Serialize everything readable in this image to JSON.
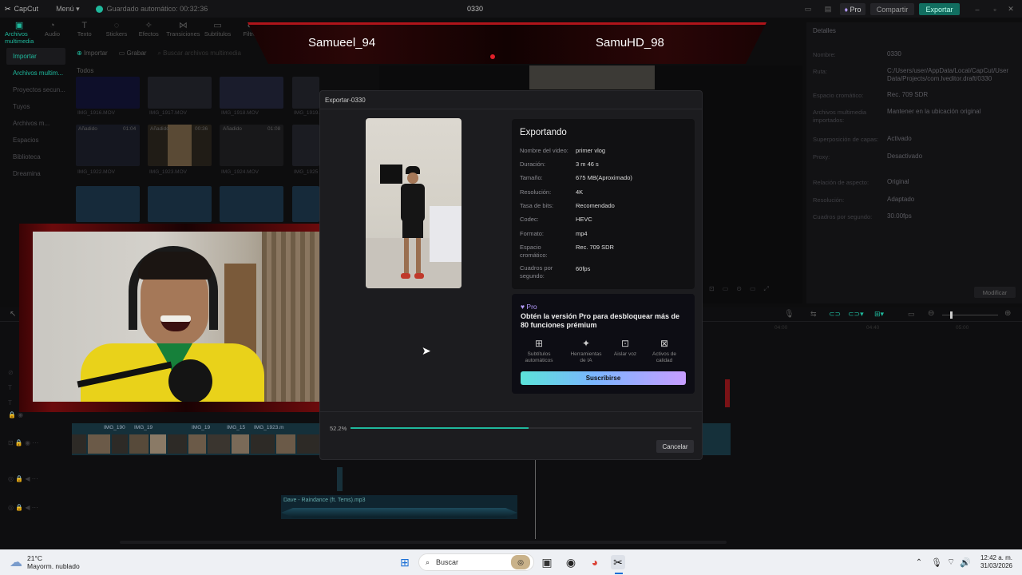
{
  "titlebar": {
    "app_name": "CapCut",
    "menu": "Menú",
    "autosave": "Guardado automático: 00:32:36",
    "project": "0330",
    "pro": "Pro",
    "share": "Compartir",
    "export": "Exportar"
  },
  "toolbar": [
    {
      "label": "Archivos multimedia",
      "icon": "media-icon"
    },
    {
      "label": "Audio",
      "icon": "audio-icon"
    },
    {
      "label": "Texto",
      "icon": "text-icon"
    },
    {
      "label": "Stickers",
      "icon": "sticker-icon"
    },
    {
      "label": "Efectos",
      "icon": "effects-icon"
    },
    {
      "label": "Transiciones",
      "icon": "transitions-icon"
    },
    {
      "label": "Subtítulos",
      "icon": "subtitles-icon"
    },
    {
      "label": "Filtro",
      "icon": "filter-icon"
    }
  ],
  "leftnav": [
    "Importar",
    "Archivos multim...",
    "Proyectos secun...",
    "Tuyos",
    "Archivos m...",
    "Espacios",
    "Biblioteca",
    "Dreamina"
  ],
  "media": {
    "import": "Importar",
    "record": "Grabar",
    "search_placeholder": "Buscar archivos multimedia",
    "all": "Todos",
    "clips": [
      {
        "name": "IMG_1916.MOV",
        "badge": "",
        "dur": ""
      },
      {
        "name": "IMG_1917.MOV",
        "badge": "",
        "dur": ""
      },
      {
        "name": "IMG_1918.MOV",
        "badge": "",
        "dur": ""
      },
      {
        "name": "IMG_1919.MOV",
        "badge": "",
        "dur": ""
      },
      {
        "name": "IMG_1922.MOV",
        "badge": "Añadido",
        "dur": "01:04"
      },
      {
        "name": "IMG_1923.MOV",
        "badge": "Añadido",
        "dur": "00:36"
      },
      {
        "name": "IMG_1924.MOV",
        "badge": "Añadido",
        "dur": "01:08"
      },
      {
        "name": "IMG_1925",
        "badge": "",
        "dur": ""
      }
    ]
  },
  "overlay": {
    "left_name": "Samueel_94",
    "right_name": "SamuHD_98"
  },
  "dialog": {
    "title": "Exportar-0330",
    "heading": "Exportando",
    "rows": [
      {
        "label": "Nombre del video:",
        "value": "primer vlog"
      },
      {
        "label": "Duración:",
        "value": "3 m 46 s"
      },
      {
        "label": "Tamaño:",
        "value": "675 MB(Aproximado)"
      },
      {
        "label": "Resolución:",
        "value": "4K"
      },
      {
        "label": "Tasa de bits:",
        "value": "Recomendado"
      },
      {
        "label": "Codec:",
        "value": "HEVC"
      },
      {
        "label": "Formato:",
        "value": "mp4"
      },
      {
        "label": "Espacio cromático:",
        "value": "Rec. 709 SDR"
      },
      {
        "label": "Cuadros por segundo:",
        "value": "60fps"
      }
    ],
    "pro": {
      "tag": "Pro",
      "message": "Obtén la versión Pro para desbloquear más de 80 funciones prémium",
      "features": [
        {
          "label": "Subtítulos automáticos",
          "icon": "captions-icon"
        },
        {
          "label": "Herramientas de IA",
          "icon": "ai-tools-icon"
        },
        {
          "label": "Aislar voz",
          "icon": "isolate-voice-icon"
        },
        {
          "label": "Activos de calidad",
          "icon": "quality-assets-icon"
        }
      ],
      "subscribe": "Suscribirse"
    },
    "progress_text": "52.2%",
    "progress": 0.522,
    "cancel": "Cancelar"
  },
  "details": {
    "title": "Detalles",
    "rows": [
      {
        "label": "Nombre:",
        "value": "0330"
      },
      {
        "label": "Ruta:",
        "value": "C:/Users/user/AppData/Local/CapCut/User Data/Projects/com.lveditor.draft/0330"
      },
      {
        "label": "Espacio cromático:",
        "value": "Rec. 709 SDR"
      },
      {
        "label": "Archivos multimedia importados:",
        "value": "Mantener en la ubicación original"
      },
      {
        "label": "Superposición de capas:",
        "value": "Activado"
      },
      {
        "label": "Proxy:",
        "value": "Desactivado"
      },
      {
        "label": "Relación de aspecto:",
        "value": "Original"
      },
      {
        "label": "Resolución:",
        "value": "Adaptado"
      },
      {
        "label": "Cuadros por segundo:",
        "value": "30.00fps"
      }
    ],
    "modify": "Modificar"
  },
  "timeline": {
    "audio_clip": "Dave - Raindance (ft. Tems).mp3",
    "times": [
      "00:00",
      "04:00",
      "04:40",
      "05:00"
    ],
    "clip_labels": [
      "IMG_190",
      "IMG_19",
      "IMG_19",
      "IMG_15",
      "IMG_1923.m"
    ]
  },
  "taskbar": {
    "temp": "21°C",
    "weather": "Mayorm. nublado",
    "search": "Buscar",
    "time": "12:42 a. m.",
    "date": "31/03/2026"
  },
  "colors": {
    "accent": "#1fb89c",
    "banner_red": "#b0141a"
  }
}
